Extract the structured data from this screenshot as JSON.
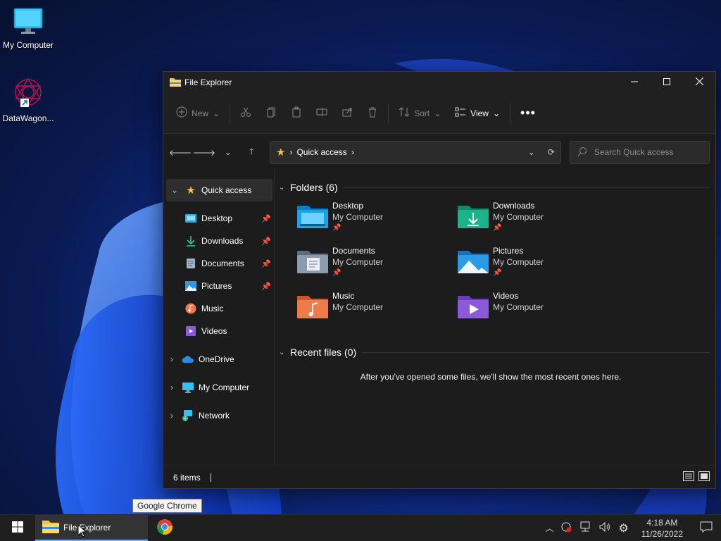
{
  "desktop": {
    "icons": [
      {
        "label": "My Computer",
        "icon": "monitor-icon"
      },
      {
        "label": "DataWagon...",
        "icon": "datawagon-logo-icon"
      }
    ]
  },
  "window": {
    "title": "File Explorer",
    "controls": [
      "minimize-icon",
      "maximize-icon",
      "close-icon"
    ]
  },
  "cmdbar": {
    "new_label": "New",
    "sort_label": "Sort",
    "view_label": "View"
  },
  "address": {
    "path": "Quick access"
  },
  "search": {
    "placeholder": "Search Quick access"
  },
  "nav": {
    "quick_access": "Quick access",
    "pinned": [
      {
        "label": "Desktop",
        "icon": "desktop-folder-icon",
        "pinned": true
      },
      {
        "label": "Downloads",
        "icon": "download-icon",
        "pinned": true
      },
      {
        "label": "Documents",
        "icon": "documents-icon",
        "pinned": true
      },
      {
        "label": "Pictures",
        "icon": "pictures-icon",
        "pinned": true
      },
      {
        "label": "Music",
        "icon": "music-icon",
        "pinned": false
      },
      {
        "label": "Videos",
        "icon": "videos-icon",
        "pinned": false
      }
    ],
    "groups": [
      {
        "label": "OneDrive",
        "icon": "cloud-icon"
      },
      {
        "label": "My Computer",
        "icon": "monitor-icon"
      },
      {
        "label": "Network",
        "icon": "network-icon"
      }
    ]
  },
  "content": {
    "folders_header": "Folders (6)",
    "folders": [
      {
        "name": "Desktop",
        "location": "My Computer",
        "pinned": true,
        "color": "#1aa3e8"
      },
      {
        "name": "Downloads",
        "location": "My Computer",
        "pinned": true,
        "color": "#1db38a"
      },
      {
        "name": "Documents",
        "location": "My Computer",
        "pinned": true,
        "color": "#8c9bb0"
      },
      {
        "name": "Pictures",
        "location": "My Computer",
        "pinned": true,
        "color": "#2b9be8"
      },
      {
        "name": "Music",
        "location": "My Computer",
        "pinned": false,
        "color": "#f07a4a"
      },
      {
        "name": "Videos",
        "location": "My Computer",
        "pinned": false,
        "color": "#8a5ad8"
      }
    ],
    "recent_header": "Recent files (0)",
    "recent_empty": "After you've opened some files, we'll show the most recent ones here."
  },
  "status": {
    "items": "6 items"
  },
  "taskbar": {
    "active_app": "File Explorer",
    "tooltip": "Google Chrome",
    "time": "4:18 AM",
    "date": "11/26/2022"
  }
}
